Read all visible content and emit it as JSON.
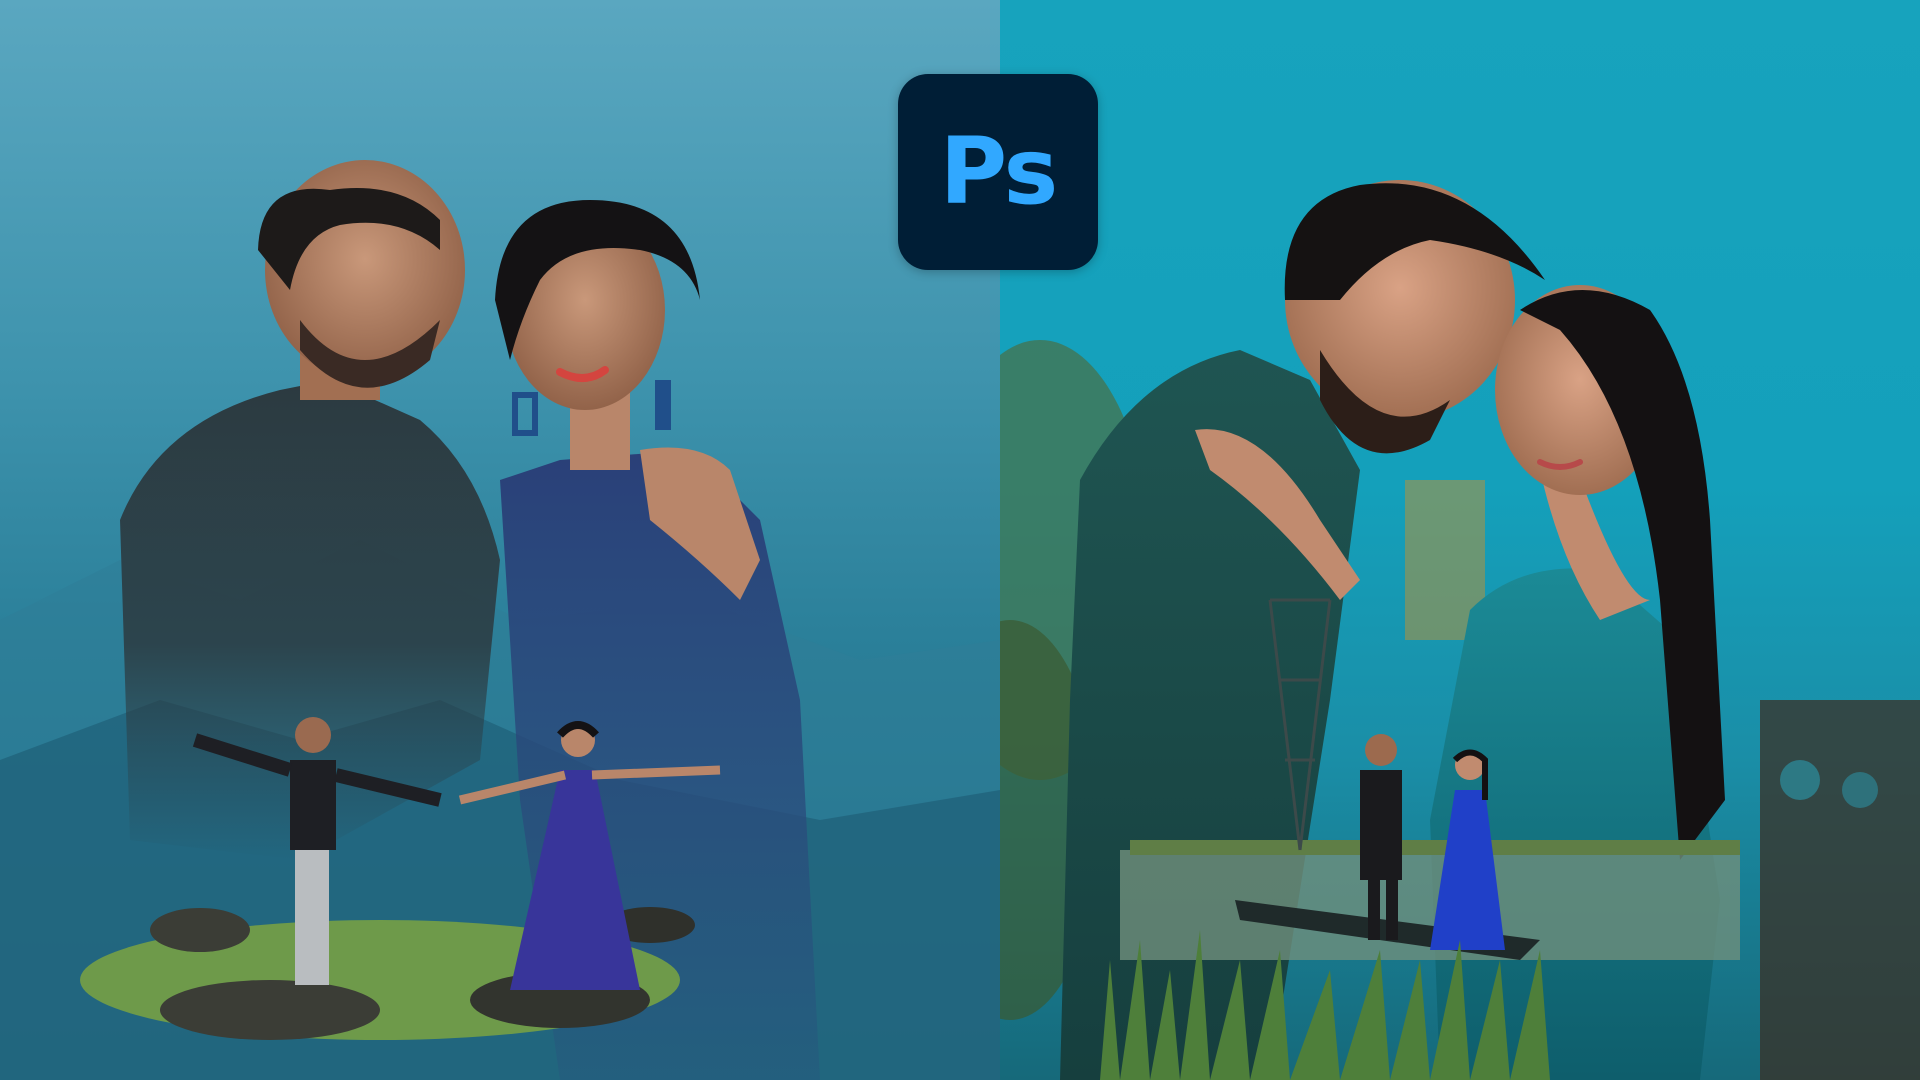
{
  "logo": {
    "text": "Ps",
    "background": "#001e36",
    "color": "#31a8ff",
    "icon": "photoshop-app-icon"
  },
  "left_photo": {
    "subject": "couple-double-exposure-mountain"
  },
  "right_photo": {
    "subject": "couple-double-exposure-lake-boat"
  },
  "colors": {
    "left_sky": "#3e93ad",
    "right_sky": "#14a0bb"
  }
}
